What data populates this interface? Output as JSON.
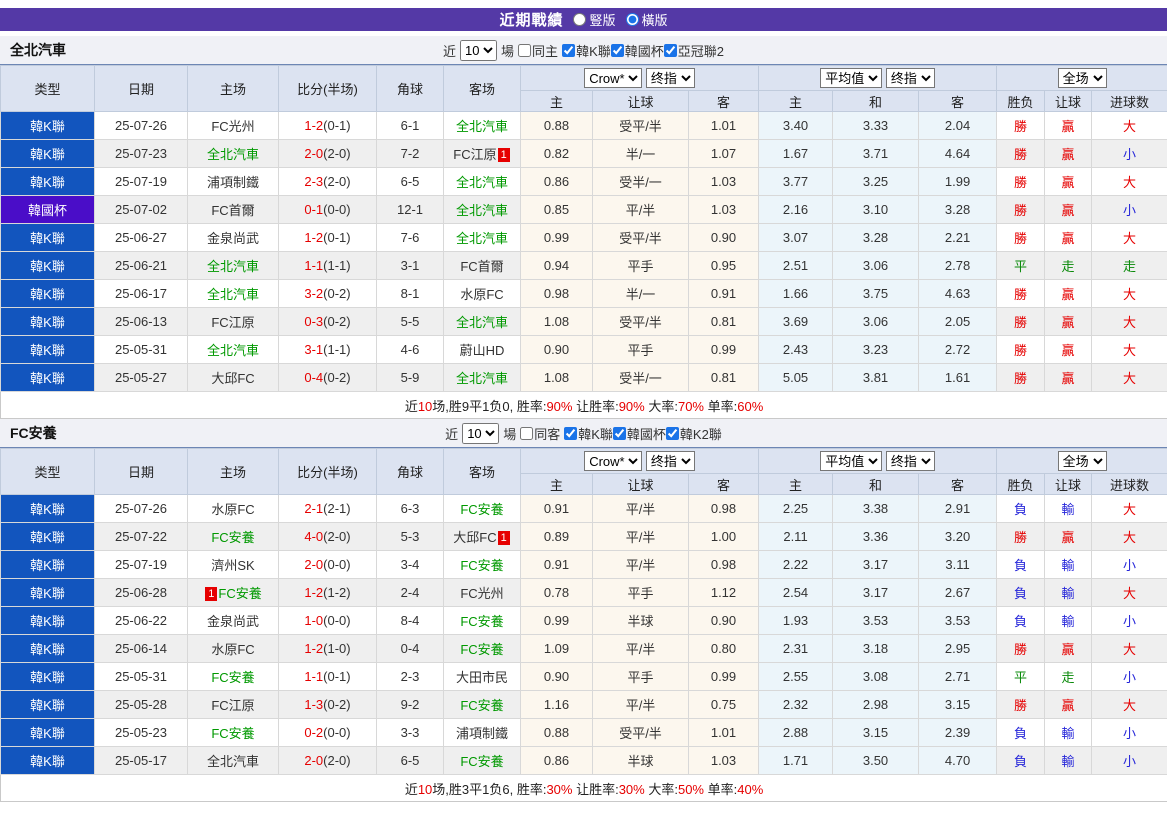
{
  "colors": {
    "titlebar_bg": "#5439A6",
    "league_k_bg": "#1255BE",
    "league_cup_bg": "#4A0DC8",
    "focus_team_green": "#009900",
    "score_red": "#E60000",
    "result_red": "#E60000",
    "result_blue": "#2626D9",
    "result_green": "#0A8A0A",
    "header_bg": "#DCE3F1",
    "asian_col_bg": "#FCF7EE",
    "euro_col_bg": "#ECF5FA",
    "alt_row_bg": "#EFEFEF",
    "accent_blue": "#1A73E8"
  },
  "title_bar": {
    "title": "近期戰績",
    "radio_vertical": "豎版",
    "radio_horizontal": "橫版",
    "selected": "橫版"
  },
  "table_headers": {
    "type": "类型",
    "date": "日期",
    "home": "主场",
    "score": "比分(半场)",
    "corner": "角球",
    "away": "客场",
    "asian": [
      "主",
      "让球",
      "客"
    ],
    "euro": [
      "主",
      "和",
      "客"
    ],
    "results": [
      "胜负",
      "让球",
      "进球数"
    ]
  },
  "result_colors": {
    "勝": "red",
    "贏": "red",
    "大": "red",
    "負": "blue",
    "輸": "blue",
    "小": "blue",
    "平": "green",
    "走": "green"
  },
  "sections": [
    {
      "team": "全北汽車",
      "controls": {
        "near": "近",
        "count": "10",
        "games": "場",
        "same_label": "同主",
        "same_checked": false,
        "leagues": [
          {
            "label": "韓K聯",
            "checked": true
          },
          {
            "label": "韓國杯",
            "checked": true
          },
          {
            "label": "亞冠聯2",
            "checked": true
          }
        ]
      },
      "selects": {
        "company": "Crow*",
        "asian_final": "终指",
        "average": "平均值",
        "euro_final": "终指",
        "scope": "全场"
      },
      "rows": [
        {
          "league": "韓K聯",
          "cup": false,
          "date": "25-07-26",
          "home": "FC光州",
          "home_focus": false,
          "home_badge": "",
          "score": "1-2",
          "half": "(0-1)",
          "corner": "6-1",
          "away": "全北汽車",
          "away_focus": true,
          "away_badge": "",
          "asian": [
            "0.88",
            "受平/半",
            "1.01"
          ],
          "euro": [
            "3.40",
            "3.33",
            "2.04"
          ],
          "results": [
            "勝",
            "贏",
            "大"
          ]
        },
        {
          "league": "韓K聯",
          "cup": false,
          "date": "25-07-23",
          "home": "全北汽車",
          "home_focus": true,
          "home_badge": "",
          "score": "2-0",
          "half": "(2-0)",
          "corner": "7-2",
          "away": "FC江原",
          "away_focus": false,
          "away_badge": "1",
          "asian": [
            "0.82",
            "半/一",
            "1.07"
          ],
          "euro": [
            "1.67",
            "3.71",
            "4.64"
          ],
          "results": [
            "勝",
            "贏",
            "小"
          ]
        },
        {
          "league": "韓K聯",
          "cup": false,
          "date": "25-07-19",
          "home": "浦項制鐵",
          "home_focus": false,
          "home_badge": "",
          "score": "2-3",
          "half": "(2-0)",
          "corner": "6-5",
          "away": "全北汽車",
          "away_focus": true,
          "away_badge": "",
          "asian": [
            "0.86",
            "受半/一",
            "1.03"
          ],
          "euro": [
            "3.77",
            "3.25",
            "1.99"
          ],
          "results": [
            "勝",
            "贏",
            "大"
          ]
        },
        {
          "league": "韓國杯",
          "cup": true,
          "date": "25-07-02",
          "home": "FC首爾",
          "home_focus": false,
          "home_badge": "",
          "score": "0-1",
          "half": "(0-0)",
          "corner": "12-1",
          "away": "全北汽車",
          "away_focus": true,
          "away_badge": "",
          "asian": [
            "0.85",
            "平/半",
            "1.03"
          ],
          "euro": [
            "2.16",
            "3.10",
            "3.28"
          ],
          "results": [
            "勝",
            "贏",
            "小"
          ]
        },
        {
          "league": "韓K聯",
          "cup": false,
          "date": "25-06-27",
          "home": "金泉尚武",
          "home_focus": false,
          "home_badge": "",
          "score": "1-2",
          "half": "(0-1)",
          "corner": "7-6",
          "away": "全北汽車",
          "away_focus": true,
          "away_badge": "",
          "asian": [
            "0.99",
            "受平/半",
            "0.90"
          ],
          "euro": [
            "3.07",
            "3.28",
            "2.21"
          ],
          "results": [
            "勝",
            "贏",
            "大"
          ]
        },
        {
          "league": "韓K聯",
          "cup": false,
          "date": "25-06-21",
          "home": "全北汽車",
          "home_focus": true,
          "home_badge": "",
          "score": "1-1",
          "half": "(1-1)",
          "corner": "3-1",
          "away": "FC首爾",
          "away_focus": false,
          "away_badge": "",
          "asian": [
            "0.94",
            "平手",
            "0.95"
          ],
          "euro": [
            "2.51",
            "3.06",
            "2.78"
          ],
          "results": [
            "平",
            "走",
            "走"
          ]
        },
        {
          "league": "韓K聯",
          "cup": false,
          "date": "25-06-17",
          "home": "全北汽車",
          "home_focus": true,
          "home_badge": "",
          "score": "3-2",
          "half": "(0-2)",
          "corner": "8-1",
          "away": "水原FC",
          "away_focus": false,
          "away_badge": "",
          "asian": [
            "0.98",
            "半/一",
            "0.91"
          ],
          "euro": [
            "1.66",
            "3.75",
            "4.63"
          ],
          "results": [
            "勝",
            "贏",
            "大"
          ]
        },
        {
          "league": "韓K聯",
          "cup": false,
          "date": "25-06-13",
          "home": "FC江原",
          "home_focus": false,
          "home_badge": "",
          "score": "0-3",
          "half": "(0-2)",
          "corner": "5-5",
          "away": "全北汽車",
          "away_focus": true,
          "away_badge": "",
          "asian": [
            "1.08",
            "受平/半",
            "0.81"
          ],
          "euro": [
            "3.69",
            "3.06",
            "2.05"
          ],
          "results": [
            "勝",
            "贏",
            "大"
          ]
        },
        {
          "league": "韓K聯",
          "cup": false,
          "date": "25-05-31",
          "home": "全北汽車",
          "home_focus": true,
          "home_badge": "",
          "score": "3-1",
          "half": "(1-1)",
          "corner": "4-6",
          "away": "蔚山HD",
          "away_focus": false,
          "away_badge": "",
          "asian": [
            "0.90",
            "平手",
            "0.99"
          ],
          "euro": [
            "2.43",
            "3.23",
            "2.72"
          ],
          "results": [
            "勝",
            "贏",
            "大"
          ]
        },
        {
          "league": "韓K聯",
          "cup": false,
          "date": "25-05-27",
          "home": "大邱FC",
          "home_focus": false,
          "home_badge": "",
          "score": "0-4",
          "half": "(0-2)",
          "corner": "5-9",
          "away": "全北汽車",
          "away_focus": true,
          "away_badge": "",
          "asian": [
            "1.08",
            "受半/一",
            "0.81"
          ],
          "euro": [
            "5.05",
            "3.81",
            "1.61"
          ],
          "results": [
            "勝",
            "贏",
            "大"
          ]
        }
      ],
      "summary": [
        [
          "近",
          "k"
        ],
        [
          "10",
          "r"
        ],
        [
          "场,胜9平1负0, 胜率:",
          "k"
        ],
        [
          "90%",
          "r"
        ],
        [
          " 让胜率:",
          "k"
        ],
        [
          "90%",
          "r"
        ],
        [
          " 大率:",
          "k"
        ],
        [
          "70%",
          "r"
        ],
        [
          " 单率:",
          "k"
        ],
        [
          "60%",
          "r"
        ]
      ]
    },
    {
      "team": "FC安養",
      "controls": {
        "near": "近",
        "count": "10",
        "games": "場",
        "same_label": "同客",
        "same_checked": false,
        "leagues": [
          {
            "label": "韓K聯",
            "checked": true
          },
          {
            "label": "韓國杯",
            "checked": true
          },
          {
            "label": "韓K2聯",
            "checked": true
          }
        ]
      },
      "selects": {
        "company": "Crow*",
        "asian_final": "终指",
        "average": "平均值",
        "euro_final": "终指",
        "scope": "全场"
      },
      "rows": [
        {
          "league": "韓K聯",
          "cup": false,
          "date": "25-07-26",
          "home": "水原FC",
          "home_focus": false,
          "home_badge": "",
          "score": "2-1",
          "half": "(2-1)",
          "corner": "6-3",
          "away": "FC安養",
          "away_focus": true,
          "away_badge": "",
          "asian": [
            "0.91",
            "平/半",
            "0.98"
          ],
          "euro": [
            "2.25",
            "3.38",
            "2.91"
          ],
          "results": [
            "負",
            "輸",
            "大"
          ]
        },
        {
          "league": "韓K聯",
          "cup": false,
          "date": "25-07-22",
          "home": "FC安養",
          "home_focus": true,
          "home_badge": "",
          "score": "4-0",
          "half": "(2-0)",
          "corner": "5-3",
          "away": "大邱FC",
          "away_focus": false,
          "away_badge": "1",
          "asian": [
            "0.89",
            "平/半",
            "1.00"
          ],
          "euro": [
            "2.11",
            "3.36",
            "3.20"
          ],
          "results": [
            "勝",
            "贏",
            "大"
          ]
        },
        {
          "league": "韓K聯",
          "cup": false,
          "date": "25-07-19",
          "home": "濟州SK",
          "home_focus": false,
          "home_badge": "",
          "score": "2-0",
          "half": "(0-0)",
          "corner": "3-4",
          "away": "FC安養",
          "away_focus": true,
          "away_badge": "",
          "asian": [
            "0.91",
            "平/半",
            "0.98"
          ],
          "euro": [
            "2.22",
            "3.17",
            "3.11"
          ],
          "results": [
            "負",
            "輸",
            "小"
          ]
        },
        {
          "league": "韓K聯",
          "cup": false,
          "date": "25-06-28",
          "home": "FC安養",
          "home_focus": true,
          "home_badge": "1",
          "score": "1-2",
          "half": "(1-2)",
          "corner": "2-4",
          "away": "FC光州",
          "away_focus": false,
          "away_badge": "",
          "asian": [
            "0.78",
            "平手",
            "1.12"
          ],
          "euro": [
            "2.54",
            "3.17",
            "2.67"
          ],
          "results": [
            "負",
            "輸",
            "大"
          ]
        },
        {
          "league": "韓K聯",
          "cup": false,
          "date": "25-06-22",
          "home": "金泉尚武",
          "home_focus": false,
          "home_badge": "",
          "score": "1-0",
          "half": "(0-0)",
          "corner": "8-4",
          "away": "FC安養",
          "away_focus": true,
          "away_badge": "",
          "asian": [
            "0.99",
            "半球",
            "0.90"
          ],
          "euro": [
            "1.93",
            "3.53",
            "3.53"
          ],
          "results": [
            "負",
            "輸",
            "小"
          ]
        },
        {
          "league": "韓K聯",
          "cup": false,
          "date": "25-06-14",
          "home": "水原FC",
          "home_focus": false,
          "home_badge": "",
          "score": "1-2",
          "half": "(1-0)",
          "corner": "0-4",
          "away": "FC安養",
          "away_focus": true,
          "away_badge": "",
          "asian": [
            "1.09",
            "平/半",
            "0.80"
          ],
          "euro": [
            "2.31",
            "3.18",
            "2.95"
          ],
          "results": [
            "勝",
            "贏",
            "大"
          ]
        },
        {
          "league": "韓K聯",
          "cup": false,
          "date": "25-05-31",
          "home": "FC安養",
          "home_focus": true,
          "home_badge": "",
          "score": "1-1",
          "half": "(0-1)",
          "corner": "2-3",
          "away": "大田市民",
          "away_focus": false,
          "away_badge": "",
          "asian": [
            "0.90",
            "平手",
            "0.99"
          ],
          "euro": [
            "2.55",
            "3.08",
            "2.71"
          ],
          "results": [
            "平",
            "走",
            "小"
          ]
        },
        {
          "league": "韓K聯",
          "cup": false,
          "date": "25-05-28",
          "home": "FC江原",
          "home_focus": false,
          "home_badge": "",
          "score": "1-3",
          "half": "(0-2)",
          "corner": "9-2",
          "away": "FC安養",
          "away_focus": true,
          "away_badge": "",
          "asian": [
            "1.16",
            "平/半",
            "0.75"
          ],
          "euro": [
            "2.32",
            "2.98",
            "3.15"
          ],
          "results": [
            "勝",
            "贏",
            "大"
          ]
        },
        {
          "league": "韓K聯",
          "cup": false,
          "date": "25-05-23",
          "home": "FC安養",
          "home_focus": true,
          "home_badge": "",
          "score": "0-2",
          "half": "(0-0)",
          "corner": "3-3",
          "away": "浦項制鐵",
          "away_focus": false,
          "away_badge": "",
          "asian": [
            "0.88",
            "受平/半",
            "1.01"
          ],
          "euro": [
            "2.88",
            "3.15",
            "2.39"
          ],
          "results": [
            "負",
            "輸",
            "小"
          ]
        },
        {
          "league": "韓K聯",
          "cup": false,
          "date": "25-05-17",
          "home": "全北汽車",
          "home_focus": false,
          "home_badge": "",
          "score": "2-0",
          "half": "(2-0)",
          "corner": "6-5",
          "away": "FC安養",
          "away_focus": true,
          "away_badge": "",
          "asian": [
            "0.86",
            "半球",
            "1.03"
          ],
          "euro": [
            "1.71",
            "3.50",
            "4.70"
          ],
          "results": [
            "負",
            "輸",
            "小"
          ]
        }
      ],
      "summary": [
        [
          "近",
          "k"
        ],
        [
          "10",
          "r"
        ],
        [
          "场,胜3平1负6, 胜率:",
          "k"
        ],
        [
          "30%",
          "r"
        ],
        [
          " 让胜率:",
          "k"
        ],
        [
          "30%",
          "r"
        ],
        [
          " 大率:",
          "k"
        ],
        [
          "50%",
          "r"
        ],
        [
          " 单率:",
          "k"
        ],
        [
          "40%",
          "r"
        ]
      ]
    }
  ]
}
